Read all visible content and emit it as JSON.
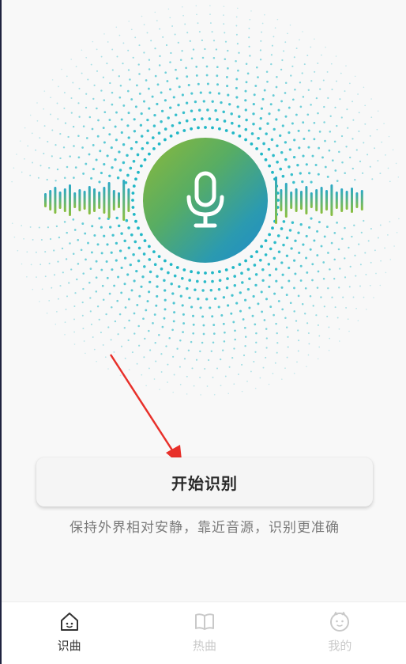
{
  "main": {
    "start_button_label": "开始识别",
    "hint_text": "保持外界相对安静，靠近音源，识别更准确"
  },
  "tabbar": {
    "tabs": [
      {
        "label": "识曲",
        "icon": "home-face-icon",
        "active": true
      },
      {
        "label": "热曲",
        "icon": "book-icon",
        "active": false
      },
      {
        "label": "我的",
        "icon": "face-icon",
        "active": false
      }
    ]
  },
  "colors": {
    "accent_green": "#8cb93a",
    "accent_blue": "#1f8bc9",
    "dot_teal": "#1fb7c6",
    "arrow_red": "#e8302a"
  }
}
